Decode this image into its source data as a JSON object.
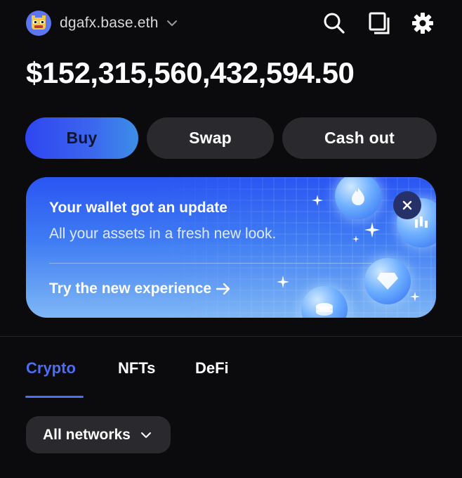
{
  "header": {
    "account_name": "dgafx.base.eth",
    "icons": [
      "search-icon",
      "copy-icon",
      "settings-icon"
    ]
  },
  "balance": "$152,315,560,432,594.50",
  "actions": {
    "buy": "Buy",
    "swap": "Swap",
    "cash_out": "Cash out"
  },
  "banner": {
    "title": "Your wallet got an update",
    "subtitle": "All your assets in a fresh new look.",
    "cta": "Try the new experience"
  },
  "tabs": [
    {
      "label": "Crypto",
      "active": true
    },
    {
      "label": "NFTs",
      "active": false
    },
    {
      "label": "DeFi",
      "active": false
    }
  ],
  "network_filter": {
    "selected": "All networks"
  },
  "colors": {
    "background": "#0b0b0d",
    "accent": "#4d6df3",
    "button_dark": "#2a2a2e"
  }
}
